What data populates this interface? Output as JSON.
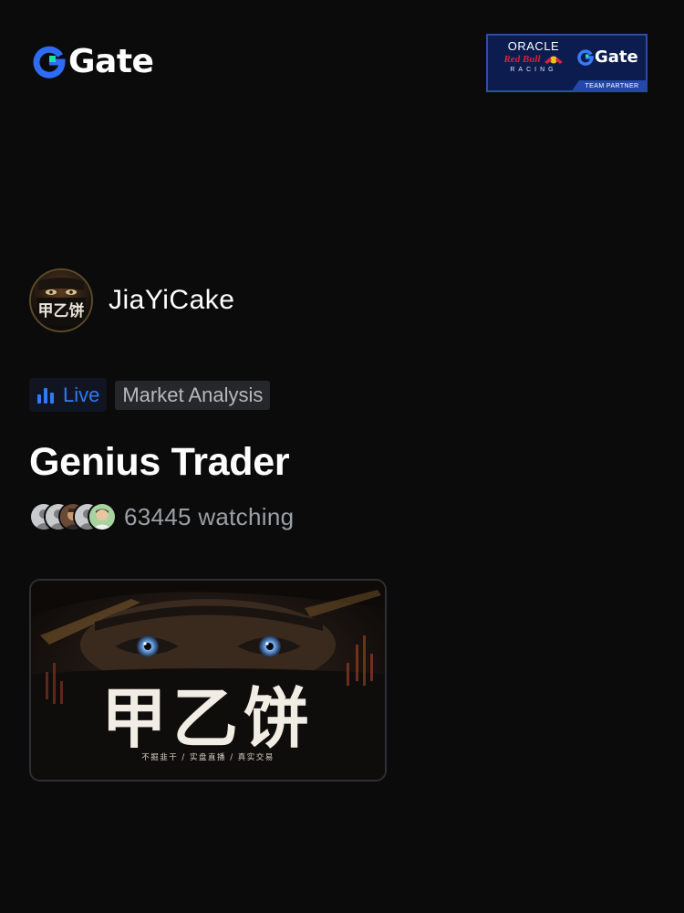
{
  "brand": {
    "name": "Gate",
    "icon": "gate-logo-icon"
  },
  "partner": {
    "oracle": "ORACLE",
    "redbull": "Red Bull",
    "racing": "RACING",
    "gate": "Gate",
    "team_partner": "TEAM PARTNER"
  },
  "host": {
    "name": "JiaYiCake",
    "avatar_text": "甲乙饼"
  },
  "tags": {
    "live": "Live",
    "category": "Market Analysis"
  },
  "stream": {
    "title": "Genius Trader",
    "viewers": "63445 watching"
  },
  "thumbnail": {
    "title_text": "甲乙饼",
    "subtitle": "不掘韭干 / 实盘直播 / 真实交易"
  },
  "colors": {
    "background": "#0b0b0c",
    "accent_blue": "#2f7af6",
    "logo_green": "#17e5a8",
    "partner_navy": "#0c1c4f"
  }
}
